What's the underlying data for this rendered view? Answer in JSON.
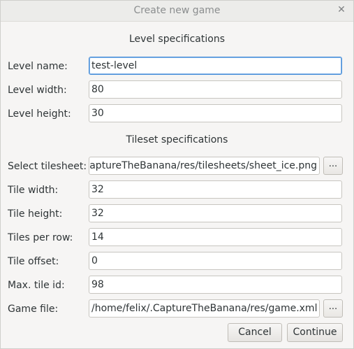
{
  "window": {
    "title": "Create new game"
  },
  "level": {
    "heading": "Level specifications",
    "name_label": "Level name:",
    "name_value": "test-level",
    "width_label": "Level width:",
    "width_value": "80",
    "height_label": "Level height:",
    "height_value": "30"
  },
  "tileset": {
    "heading": "Tileset specifications",
    "tilesheet_label": "Select tilesheet:",
    "tilesheet_value": "x/.CaptureTheBanana/res/tilesheets/sheet_ice.png",
    "tile_width_label": "Tile width:",
    "tile_width_value": "32",
    "tile_height_label": "Tile height:",
    "tile_height_value": "32",
    "tiles_per_row_label": "Tiles per row:",
    "tiles_per_row_value": "14",
    "tile_offset_label": "Tile offset:",
    "tile_offset_value": "0",
    "max_tile_id_label": "Max. tile id:",
    "max_tile_id_value": "98",
    "game_file_label": "Game file:",
    "game_file_value": "/home/felix/.CaptureTheBanana/res/game.xml"
  },
  "buttons": {
    "browse": "...",
    "cancel": "Cancel",
    "continue": "Continue"
  },
  "icons": {
    "close": "close-icon"
  }
}
